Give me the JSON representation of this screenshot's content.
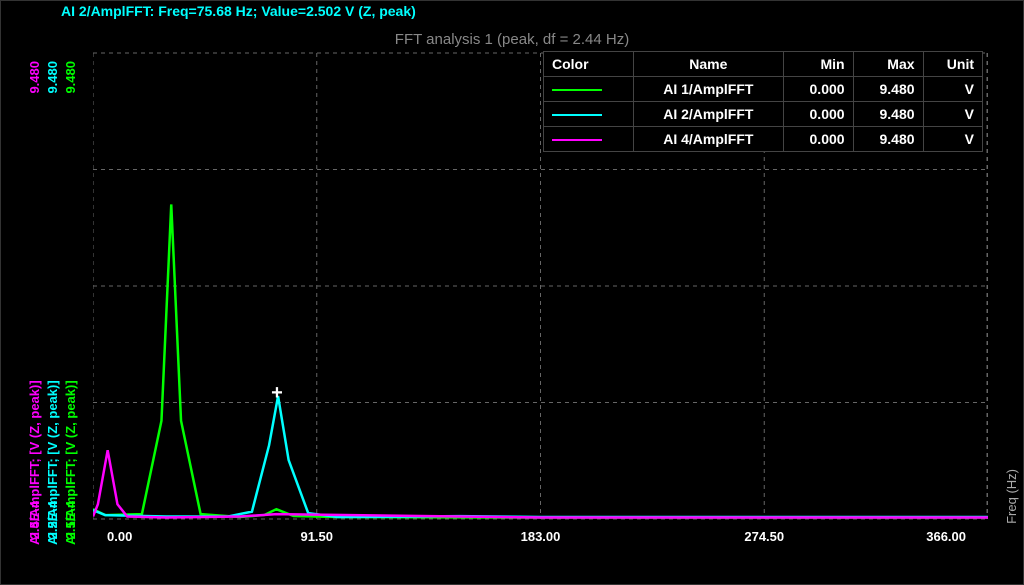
{
  "cursor_info": "AI 2/AmplFFT: Freq=75.68 Hz; Value=2.502 V (Z, peak)",
  "title": "FFT analysis 1 (peak, df = 2.44 Hz)",
  "x_axis": {
    "label": "Freq (Hz)",
    "ticks": [
      "0.00",
      "91.50",
      "183.00",
      "274.50",
      "366.00"
    ],
    "min": 0.0,
    "max": 366.0
  },
  "y_axis": {
    "min_label": "2.5E-4",
    "max_label": "9.480",
    "min": 0.00025,
    "max": 9.48,
    "channels": [
      {
        "name": "AI 4/AmplFFT; [V (Z, peak)]",
        "color": "magenta"
      },
      {
        "name": "AI 2/AmplFFT; [V (Z, peak)]",
        "color": "cyan"
      },
      {
        "name": "AI 1/AmplFFT; [V (Z, peak)]",
        "color": "green"
      }
    ]
  },
  "legend": {
    "headers": [
      "Color",
      "Name",
      "Min",
      "Max",
      "Unit"
    ],
    "rows": [
      {
        "color": "green",
        "name": "AI 1/AmplFFT",
        "min": "0.000",
        "max": "9.480",
        "unit": "V"
      },
      {
        "color": "cyan",
        "name": "AI 2/AmplFFT",
        "min": "0.000",
        "max": "9.480",
        "unit": "V"
      },
      {
        "color": "magenta",
        "name": "AI 4/AmplFFT",
        "min": "0.000",
        "max": "9.480",
        "unit": "V"
      }
    ]
  },
  "cursor": {
    "freq": 75.68,
    "value": 2.502
  },
  "chart_data": {
    "type": "line",
    "title": "FFT analysis 1 (peak, df = 2.44 Hz)",
    "xlabel": "Freq (Hz)",
    "ylabel": "V (Z, peak)",
    "xlim": [
      0,
      366
    ],
    "ylim": [
      0.00025,
      9.48
    ],
    "series": [
      {
        "name": "AI 1/AmplFFT",
        "color": "#00ff00",
        "x": [
          0,
          5,
          20,
          28,
          32,
          36,
          44,
          60,
          70,
          75,
          82,
          100,
          183,
          274,
          366
        ],
        "values": [
          0.2,
          0.08,
          0.1,
          2.0,
          6.4,
          2.0,
          0.1,
          0.04,
          0.08,
          0.2,
          0.06,
          0.04,
          0.03,
          0.03,
          0.03
        ]
      },
      {
        "name": "AI 2/AmplFFT",
        "color": "#00ffff",
        "x": [
          0,
          5,
          30,
          55,
          65,
          72,
          75.68,
          80,
          88,
          100,
          150,
          183,
          274,
          366
        ],
        "values": [
          0.18,
          0.08,
          0.05,
          0.05,
          0.15,
          1.5,
          2.5,
          1.2,
          0.12,
          0.04,
          0.06,
          0.04,
          0.04,
          0.04
        ]
      },
      {
        "name": "AI 4/AmplFFT",
        "color": "#ff00ff",
        "x": [
          0,
          2,
          6,
          10,
          14,
          30,
          60,
          75,
          150,
          183,
          274,
          366
        ],
        "values": [
          0.05,
          0.3,
          1.4,
          0.3,
          0.05,
          0.03,
          0.05,
          0.1,
          0.05,
          0.03,
          0.03,
          0.03
        ]
      }
    ]
  }
}
